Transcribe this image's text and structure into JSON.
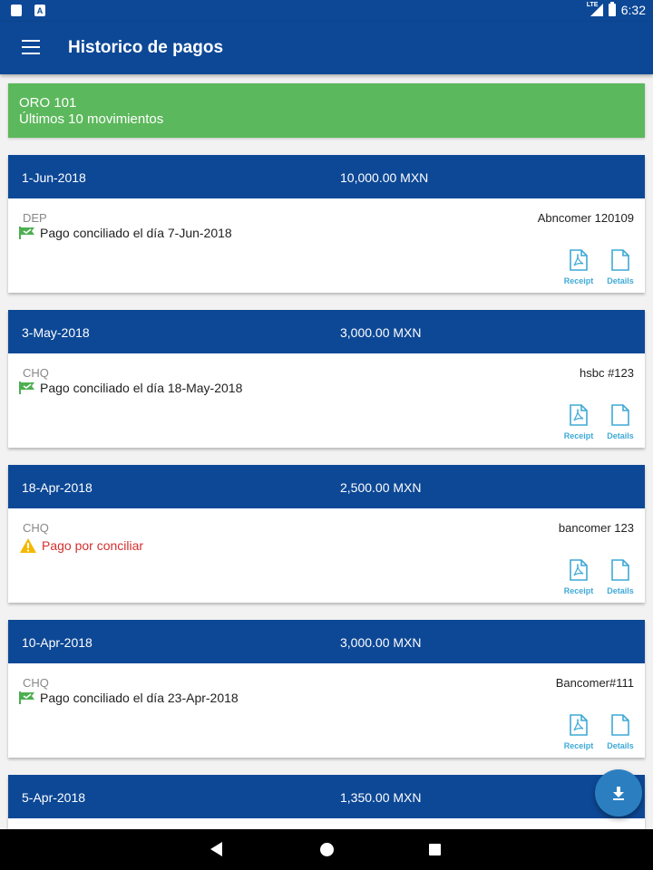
{
  "status_bar": {
    "time": "6:32",
    "network": "LTE"
  },
  "app_bar": {
    "title": "Historico de pagos"
  },
  "account": {
    "name": "ORO 101",
    "subtitle": "Últimos 10 movimientos"
  },
  "colors": {
    "primary": "#0d4896",
    "success": "#5cb85c",
    "accent": "#3fa9d6",
    "warning": "#f5b800",
    "error": "#d32f2f"
  },
  "payments": [
    {
      "date": "1-Jun-2018",
      "amount": "10,000.00 MXN",
      "type": "DEP",
      "bank": "Abncomer 120109",
      "status": "Pago conciliado el día 7-Jun-2018",
      "status_icon": "flag-icon",
      "receipt_label": "Receipt",
      "details_label": "Details"
    },
    {
      "date": "3-May-2018",
      "amount": "3,000.00 MXN",
      "type": "CHQ",
      "bank": "hsbc #123",
      "status": "Pago conciliado el día 18-May-2018",
      "status_icon": "flag-icon",
      "receipt_label": "Receipt",
      "details_label": "Details"
    },
    {
      "date": "18-Apr-2018",
      "amount": "2,500.00 MXN",
      "type": "CHQ",
      "bank": "bancomer 123",
      "status": "Pago por conciliar",
      "status_icon": "warning-icon",
      "receipt_label": "Receipt",
      "details_label": "Details"
    },
    {
      "date": "10-Apr-2018",
      "amount": "3,000.00 MXN",
      "type": "CHQ",
      "bank": "Bancomer#111",
      "status": "Pago conciliado el día 23-Apr-2018",
      "status_icon": "flag-icon",
      "receipt_label": "Receipt",
      "details_label": "Details"
    },
    {
      "date": "5-Apr-2018",
      "amount": "1,350.00 MXN"
    }
  ]
}
